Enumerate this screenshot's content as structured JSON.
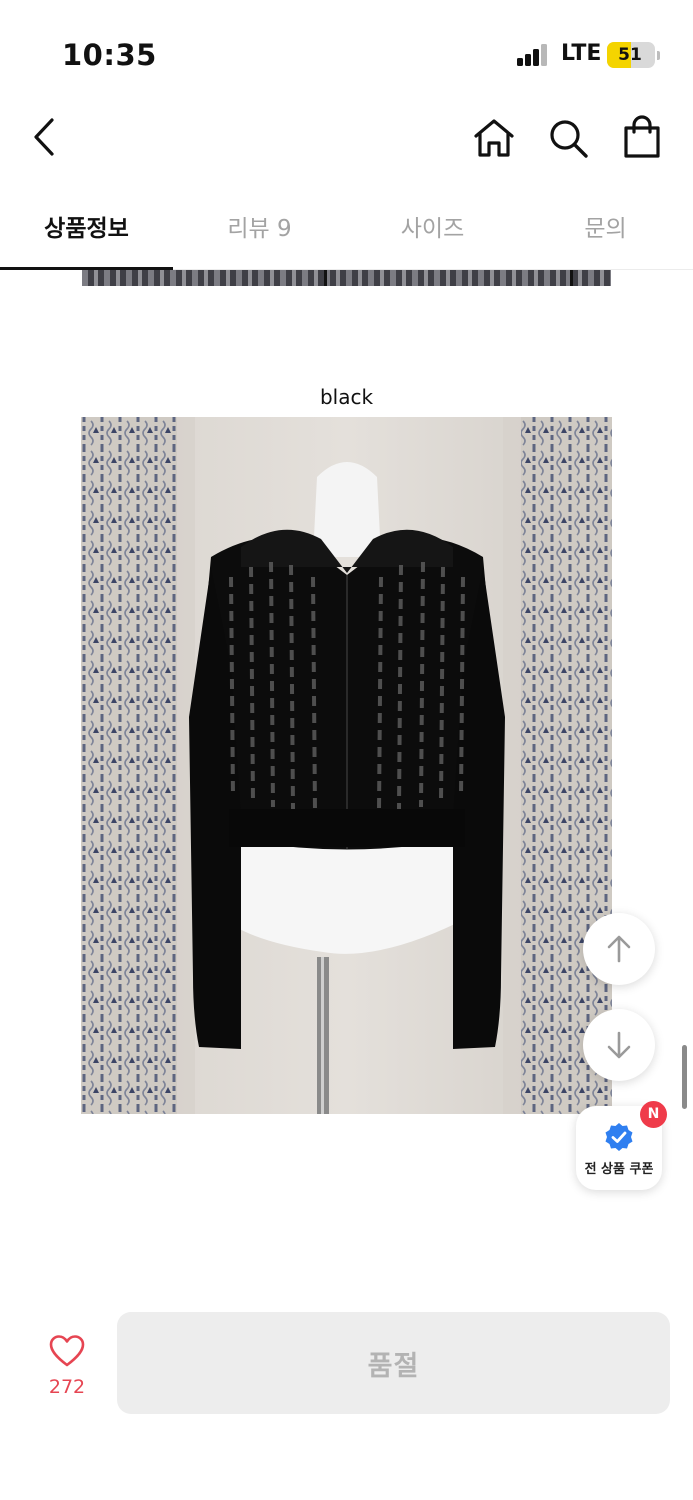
{
  "status_bar": {
    "time": "10:35",
    "network": "LTE",
    "battery": "51",
    "battery_level": 0.51
  },
  "nav": {
    "back_icon": "chevron-left-icon",
    "home_icon": "home-icon",
    "search_icon": "search-icon",
    "cart_icon": "shopping-bag-icon"
  },
  "tabs": [
    {
      "label": "상품정보",
      "active": true
    },
    {
      "label": "리뷰 9",
      "active": false
    },
    {
      "label": "사이즈",
      "active": false
    },
    {
      "label": "문의",
      "active": false
    }
  ],
  "content": {
    "caption": "black",
    "photo_subject": "black knit hooded cardigan on mannequin"
  },
  "floating": {
    "scroll_up_icon": "arrow-up-icon",
    "scroll_down_icon": "arrow-down-icon",
    "coupon_label": "전 상품 쿠폰",
    "coupon_badge": "N",
    "coupon_icon": "verified-badge-icon"
  },
  "bottom_bar": {
    "like_icon": "heart-icon",
    "like_count": "272",
    "purchase_label": "품절"
  },
  "colors": {
    "accent_red": "#e64552",
    "badge_red": "#ef3b4a",
    "coupon_blue": "#2f7ff0",
    "disabled_bg": "#ededed",
    "disabled_text": "#b3b3b3"
  }
}
